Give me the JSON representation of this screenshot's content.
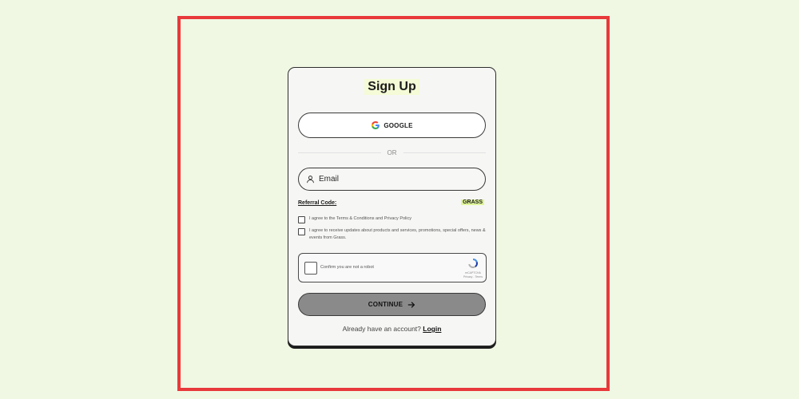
{
  "title": "Sign Up",
  "google_button": {
    "label": "GOOGLE",
    "icon": "google-g-icon"
  },
  "divider": {
    "text": "OR"
  },
  "email_field": {
    "placeholder": "Email",
    "icon": "user-icon"
  },
  "referral": {
    "label": "Referral Code:",
    "code": "GRASS"
  },
  "agreements": [
    {
      "text": "I agree to the Terms & Conditions and Privacy Policy",
      "checked": false
    },
    {
      "text": "I agree to receive updates about products and services, promotions, special offers, news & events from Grass.",
      "checked": false
    }
  ],
  "recaptcha": {
    "label": "Confirm you are not a robot",
    "brand": "reCAPTCHA",
    "links": "Privacy - Terms"
  },
  "continue_button": {
    "label": "CONTINUE",
    "icon": "arrow-right-icon"
  },
  "login_prompt": {
    "text": "Already have an account?",
    "link": "Login"
  },
  "colors": {
    "page_background": "#f0f8e4",
    "frame_border": "#e8393b",
    "card_background": "#f6f6f4",
    "continue_button": "#8a8a8a",
    "highlight": "#dff59a"
  }
}
